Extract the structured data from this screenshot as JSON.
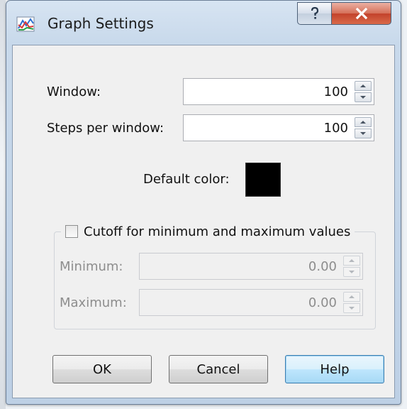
{
  "window": {
    "title": "Graph Settings",
    "icons": {
      "app": "graph-icon",
      "help": "question-icon",
      "close": "close-icon"
    }
  },
  "form": {
    "window_label": "Window:",
    "window_value": "100",
    "steps_label": "Steps per window:",
    "steps_value": "100",
    "default_color_label": "Default color:",
    "default_color": "#000000"
  },
  "cutoff": {
    "label": "Cutoff for minimum and maximum values",
    "checked": false,
    "minimum_label": "Minimum:",
    "minimum_value": "0.00",
    "maximum_label": "Maximum:",
    "maximum_value": "0.00"
  },
  "buttons": {
    "ok": "OK",
    "cancel": "Cancel",
    "help": "Help"
  },
  "colors": {
    "accent_border": "#3c7fb1",
    "close": "#c2422b"
  }
}
